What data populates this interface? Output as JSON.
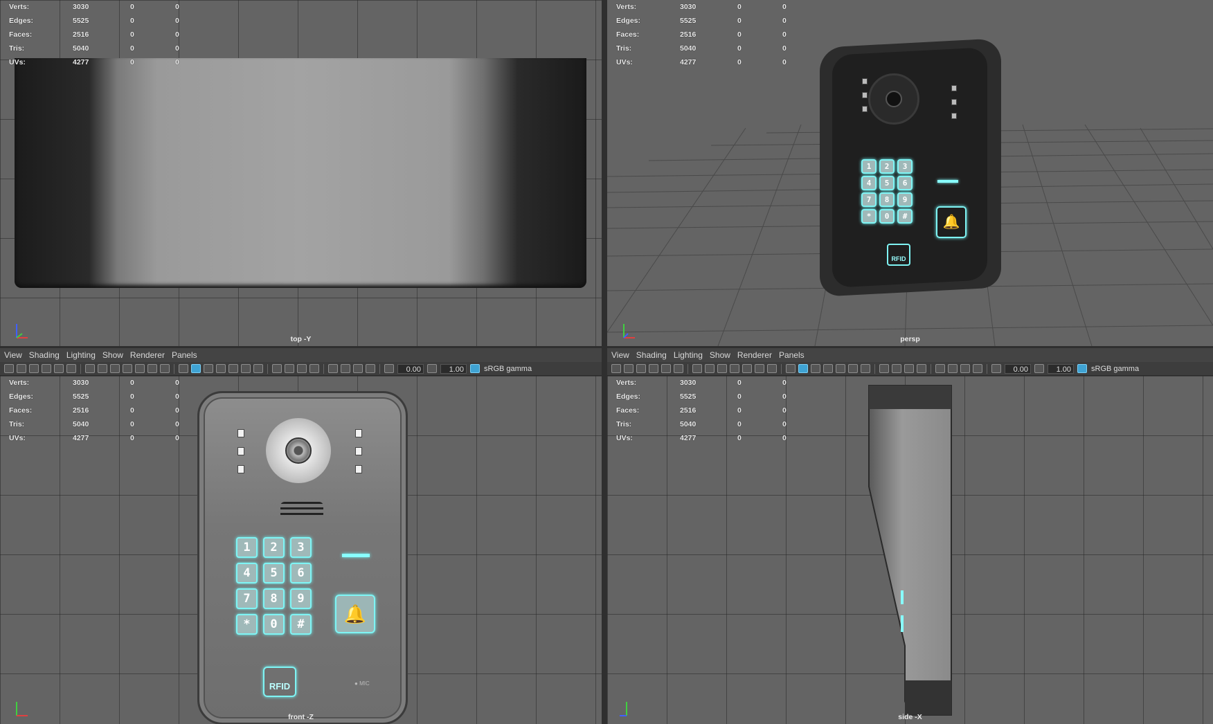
{
  "stats": [
    {
      "label": "Verts:",
      "values": [
        "3030",
        "0",
        "0"
      ]
    },
    {
      "label": "Edges:",
      "values": [
        "5525",
        "0",
        "0"
      ]
    },
    {
      "label": "Faces:",
      "values": [
        "2516",
        "0",
        "0"
      ]
    },
    {
      "label": "Tris:",
      "values": [
        "5040",
        "0",
        "0"
      ]
    },
    {
      "label": "UVs:",
      "values": [
        "4277",
        "0",
        "0"
      ]
    }
  ],
  "menu": [
    "View",
    "Shading",
    "Lighting",
    "Show",
    "Renderer",
    "Panels"
  ],
  "toolbar": {
    "exposure": "0.00",
    "gamma": "1.00",
    "colorspace": "sRGB gamma"
  },
  "panels": {
    "top": {
      "camera": "top -Y"
    },
    "persp": {
      "camera": "persp"
    },
    "front": {
      "camera": "front -Z"
    },
    "side": {
      "camera": "side -X"
    }
  },
  "keypad": [
    "1",
    "2",
    "3",
    "4",
    "5",
    "6",
    "7",
    "8",
    "9",
    "*",
    "0",
    "#"
  ],
  "labels": {
    "rfid": "RFID",
    "mic": "MIC"
  },
  "colors": {
    "viewport_bg": "#646464",
    "glow": "#7ff4f4",
    "axis_x": "#e04040",
    "axis_y": "#40d040",
    "axis_z": "#4060ff"
  }
}
